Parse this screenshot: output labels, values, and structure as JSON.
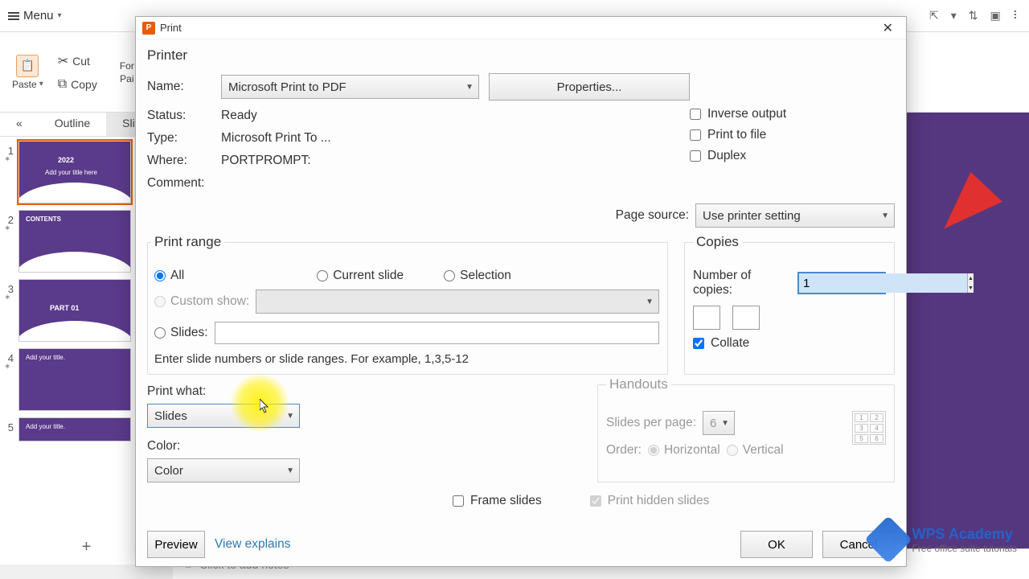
{
  "menubar": {
    "menu_label": "Menu"
  },
  "toolbar": {
    "paste": "Paste",
    "cut": "Cut",
    "copy": "Copy",
    "format_painter_l1": "For",
    "format_painter_l2": "Pai"
  },
  "sidebar": {
    "tabs": {
      "outline": "Outline",
      "slides": "Sli"
    },
    "slides": [
      {
        "num": "1",
        "title": "2022",
        "sub": "Add your title here"
      },
      {
        "num": "2",
        "title": "CONTENTS",
        "sub": ""
      },
      {
        "num": "3",
        "title": "PART 01",
        "sub": ""
      },
      {
        "num": "4",
        "title": "Add your title.",
        "sub": ""
      },
      {
        "num": "5",
        "title": "Add your title.",
        "sub": ""
      }
    ]
  },
  "notes": {
    "placeholder": "Click to add notes"
  },
  "dialog": {
    "title": "Print",
    "printer": {
      "heading": "Printer",
      "name_label": "Name:",
      "name_value": "Microsoft Print to PDF",
      "properties_btn": "Properties...",
      "status_label": "Status:",
      "status_value": "Ready",
      "type_label": "Type:",
      "type_value": "Microsoft Print To ...",
      "where_label": "Where:",
      "where_value": "PORTPROMPT:",
      "comment_label": "Comment:",
      "inverse": "Inverse output",
      "print_to_file": "Print to file",
      "duplex": "Duplex",
      "page_source_label": "Page source:",
      "page_source_value": "Use printer setting"
    },
    "range": {
      "heading": "Print range",
      "all": "All",
      "current": "Current slide",
      "selection": "Selection",
      "custom_show": "Custom show:",
      "slides": "Slides:",
      "hint": "Enter slide numbers or slide ranges. For example, 1,3,5-12"
    },
    "copies": {
      "heading": "Copies",
      "num_label": "Number of copies:",
      "num_value": "1",
      "collate": "Collate"
    },
    "print_what": {
      "label": "Print what:",
      "value": "Slides",
      "color_label": "Color:",
      "color_value": "Color"
    },
    "handouts": {
      "heading": "Handouts",
      "spp_label": "Slides per page:",
      "spp_value": "6",
      "order_label": "Order:",
      "horizontal": "Horizontal",
      "vertical": "Vertical"
    },
    "frame_slides": "Frame slides",
    "hidden_slides": "Print hidden slides",
    "footer": {
      "preview": "Preview",
      "view_explains": "View explains",
      "ok": "OK",
      "cancel": "Cancel"
    }
  },
  "watermark": {
    "brand": "WPS Academy",
    "tagline": "Free office suite tutorials"
  }
}
